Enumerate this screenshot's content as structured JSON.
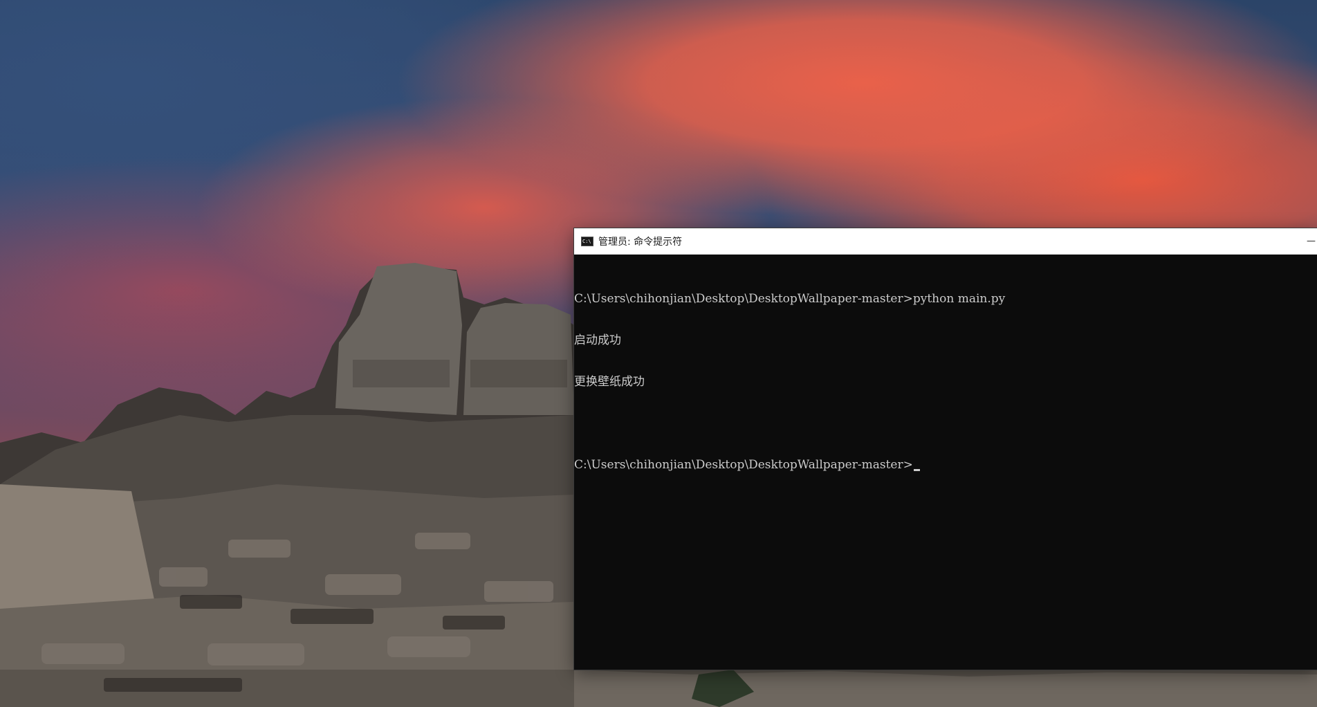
{
  "window": {
    "title": "管理员: 命令提示符",
    "icon": "cmd-icon",
    "minimize_label": "—"
  },
  "console": {
    "lines": [
      "C:\\Users\\chihonjian\\Desktop\\DesktopWallpaper-master>python main.py",
      "启动成功",
      "更换壁纸成功",
      "",
      "C:\\Users\\chihonjian\\Desktop\\DesktopWallpaper-master>"
    ]
  },
  "colors": {
    "console_bg": "#0c0c0c",
    "console_text": "#cccccc",
    "titlebar_bg": "#ffffff"
  }
}
